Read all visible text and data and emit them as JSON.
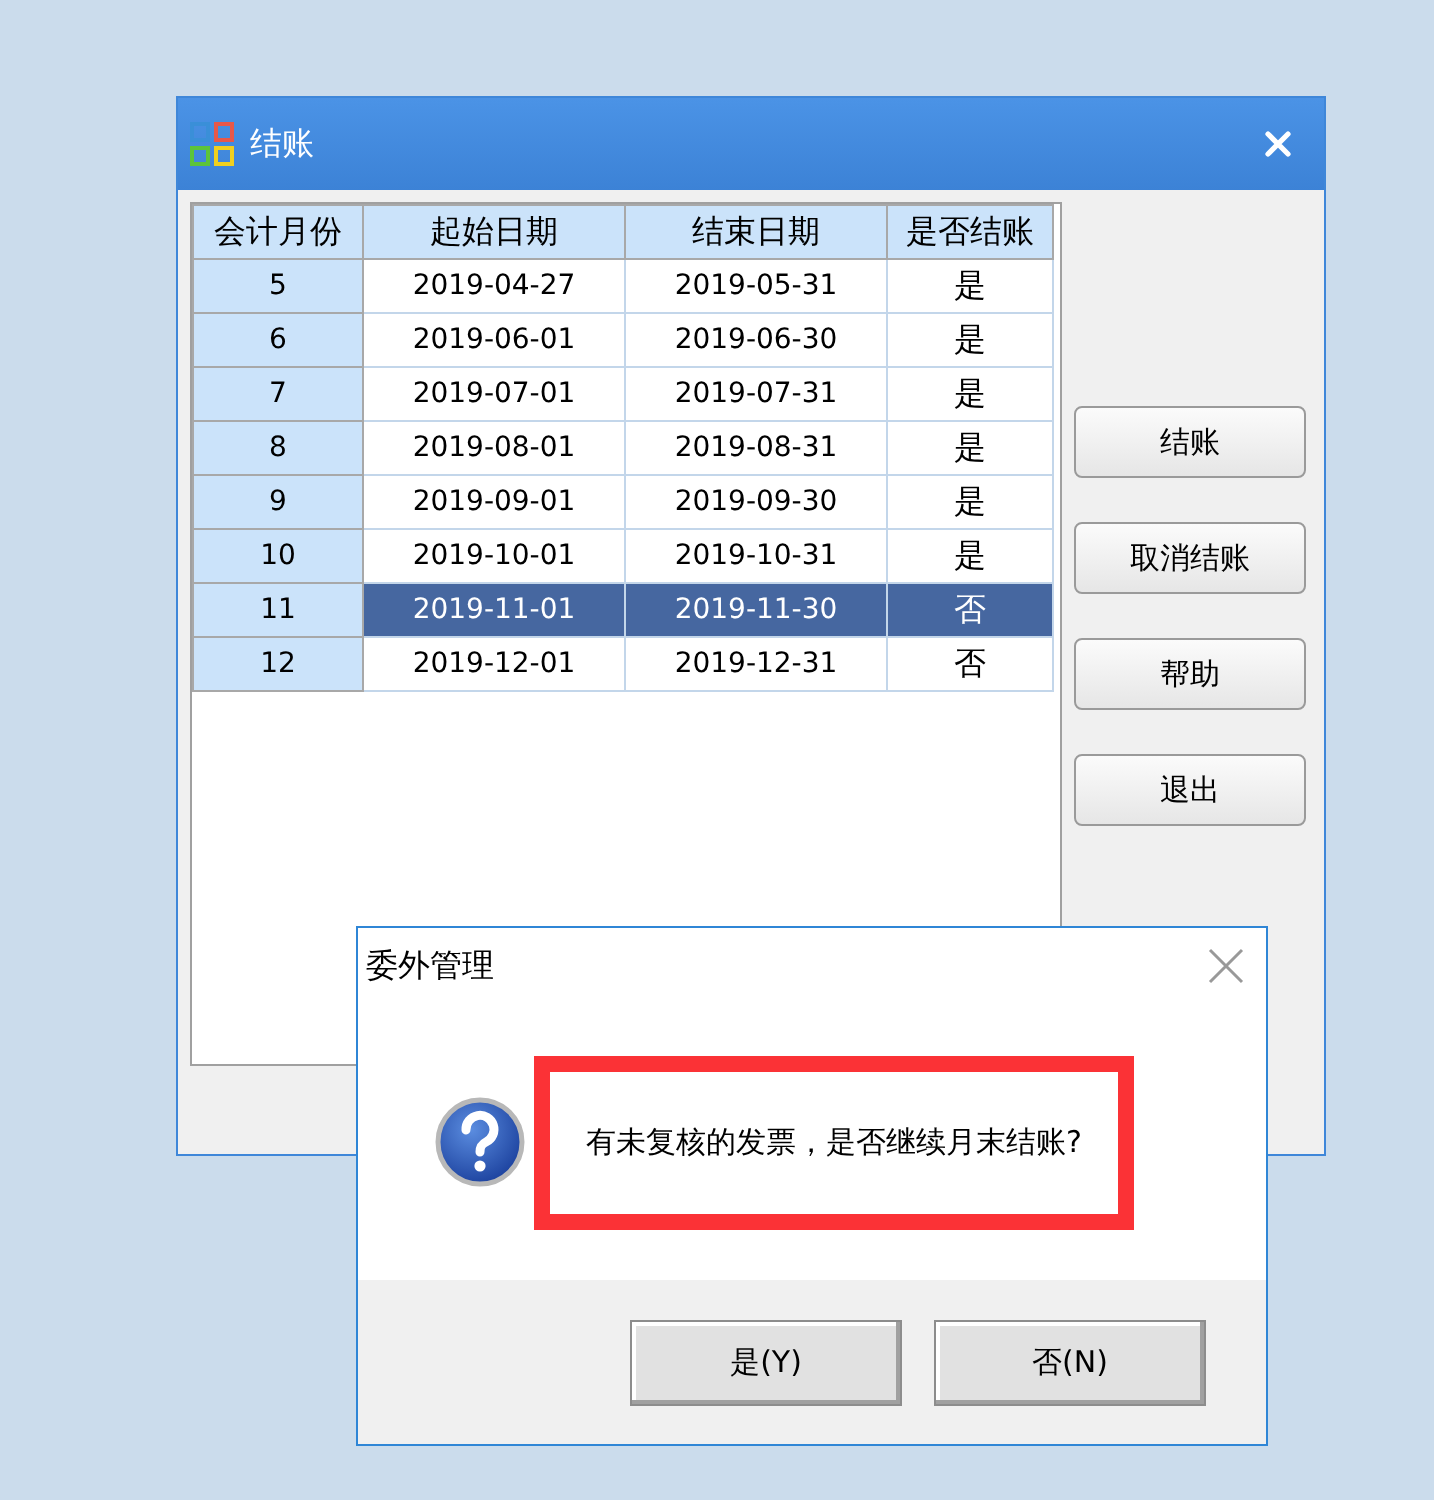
{
  "window": {
    "title": "结账"
  },
  "table": {
    "columns": [
      "会计月份",
      "起始日期",
      "结束日期",
      "是否结账"
    ],
    "rows": [
      {
        "cells": [
          "5",
          "2019-04-27",
          "2019-05-31",
          "是"
        ],
        "selected": false
      },
      {
        "cells": [
          "6",
          "2019-06-01",
          "2019-06-30",
          "是"
        ],
        "selected": false
      },
      {
        "cells": [
          "7",
          "2019-07-01",
          "2019-07-31",
          "是"
        ],
        "selected": false
      },
      {
        "cells": [
          "8",
          "2019-08-01",
          "2019-08-31",
          "是"
        ],
        "selected": false
      },
      {
        "cells": [
          "9",
          "2019-09-01",
          "2019-09-30",
          "是"
        ],
        "selected": false
      },
      {
        "cells": [
          "10",
          "2019-10-01",
          "2019-10-31",
          "是"
        ],
        "selected": false
      },
      {
        "cells": [
          "11",
          "2019-11-01",
          "2019-11-30",
          "否"
        ],
        "selected": true
      },
      {
        "cells": [
          "12",
          "2019-12-01",
          "2019-12-31",
          "否"
        ],
        "selected": false
      }
    ]
  },
  "buttons": [
    "结账",
    "取消结账",
    "帮助",
    "退出"
  ],
  "dialog": {
    "title": "委外管理",
    "message": "有未复核的发票，是否继续月末结账?",
    "highlighted": true,
    "buttons": [
      "是(Y)",
      "否(N)"
    ]
  }
}
